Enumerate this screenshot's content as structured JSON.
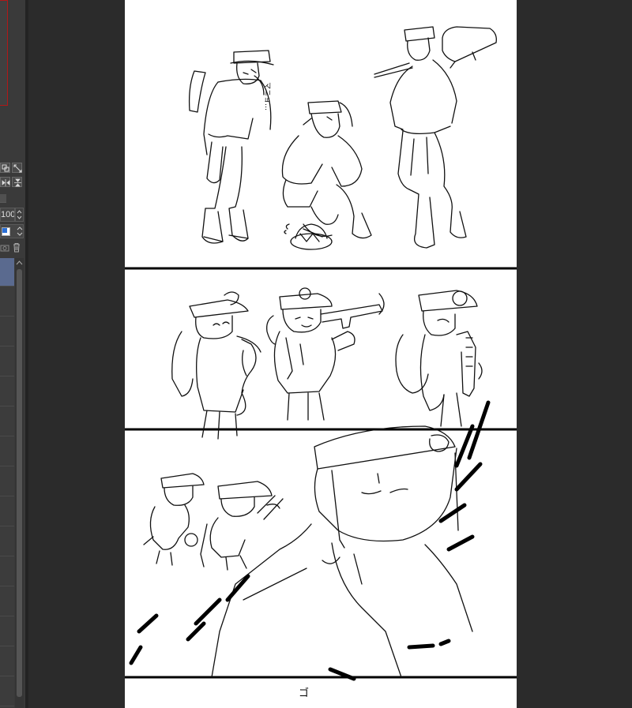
{
  "layer_panel": {
    "opacity_value": "100",
    "layer_rows": 15,
    "selected_row": 0,
    "tools": [
      {
        "name": "copy-layer-icon"
      },
      {
        "name": "expand-icon"
      },
      {
        "name": "flip-horizontal-icon"
      },
      {
        "name": "flip-vertical-icon"
      }
    ],
    "layer_icons": [
      "camera-icon",
      "trash-icon"
    ],
    "drawing_color": "#2a6fd6"
  },
  "canvas": {
    "page_color": "#ffffff",
    "panel_border_color": "#000000",
    "sfx_text_1": "マニョ…",
    "sfx_text_2": "ゴ",
    "panels": [
      {
        "name": "panel-1-three-miners-standing"
      },
      {
        "name": "panel-2-chibi-miners-with-tools"
      },
      {
        "name": "panel-3-closeup-miner-with-chibis"
      },
      {
        "name": "panel-4-partial"
      }
    ]
  }
}
